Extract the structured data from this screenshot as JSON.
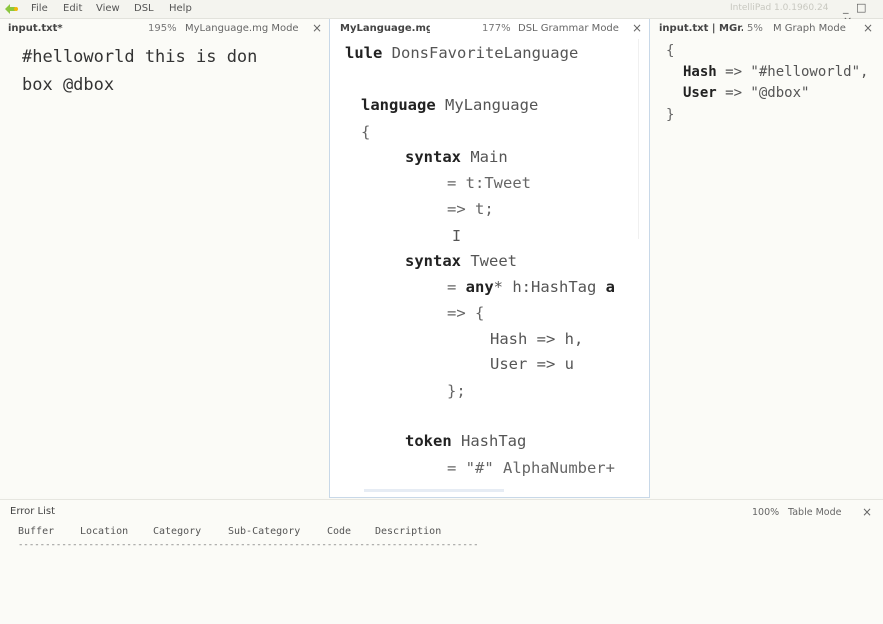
{
  "menubar": {
    "items": [
      "File",
      "Edit",
      "View",
      "DSL",
      "Help"
    ],
    "version": "IntelliPad 1.0.1960.24",
    "window_controls": "_ □ ×"
  },
  "panes": {
    "left": {
      "file": "input.txt*",
      "zoom": "195%",
      "mode": "MyLanguage.mg Mode",
      "close": "×",
      "text_lines": [
        "#helloworld this is don",
        "box @dbox"
      ]
    },
    "middle": {
      "file": "MyLanguage.mg",
      "zoom": "177%",
      "mode": "DSL Grammar Mode",
      "close": "×"
    },
    "right": {
      "file": "input.txt | MGr...",
      "zoom": "5%",
      "mode": "M Graph Mode",
      "close": "×"
    }
  },
  "grammar": {
    "l1_kw": "lule",
    "l1_id": " DonsFavoriteLanguage",
    "l2_kw": "language",
    "l2_id": " MyLanguage",
    "l3": "{",
    "l4_kw": "syntax",
    "l4_id": " Main",
    "l5": "= t:Tweet",
    "l6": "=> t;",
    "caret": "I",
    "l7_kw": "syntax",
    "l7_id": " Tweet",
    "l8_pre": "= ",
    "l8_kw": "any",
    "l8_mid": "* h:HashTag ",
    "l8_kw2": "a",
    "l9": "=> {",
    "l10": "Hash => h,",
    "l11": "User => u",
    "l12": "};",
    "l13_kw": "token",
    "l13_id": " HashTag",
    "l14": "= \"#\" AlphaNumber+"
  },
  "graph": {
    "open": "{",
    "hash_key": "Hash",
    "hash_val": " => \"#helloworld\",",
    "user_key": "User",
    "user_val": " => \"@dbox\"",
    "close": "}"
  },
  "error_list": {
    "title": "Error List",
    "zoom": "100%",
    "mode": "Table Mode",
    "close": "×",
    "columns": [
      "Buffer",
      "Location",
      "Category",
      "Sub-Category",
      "Code",
      "Description"
    ],
    "dashes": "-------------------------------------------------------------------------------------"
  }
}
